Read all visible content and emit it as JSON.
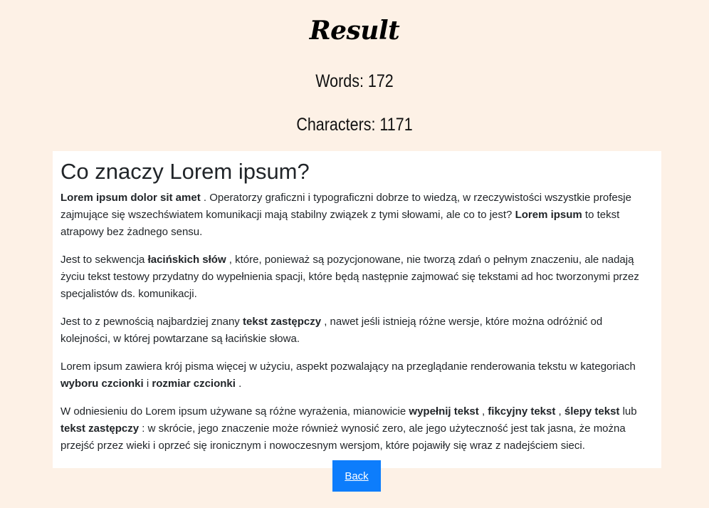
{
  "header": {
    "title": "Result",
    "words": "Words: 172",
    "characters": "Characters: 1171"
  },
  "article": {
    "heading": "Co znaczy Lorem ipsum?",
    "p1": {
      "b1": "Lorem ipsum dolor sit amet",
      "t1": " . Operatorzy graficzni i typograficzni dobrze to wiedzą, w rzeczywistości wszystkie profesje zajmujące się wszechświatem komunikacji mają stabilny związek z tymi słowami, ale co to jest? ",
      "b2": "Lorem ipsum",
      "t2": " to tekst atrapowy bez żadnego sensu."
    },
    "p2": {
      "t1": "Jest to sekwencja ",
      "b1": "łacińskich słów",
      "t2": " , które, ponieważ są pozycjonowane, nie tworzą zdań o pełnym znaczeniu, ale nadają życiu tekst testowy przydatny do wypełnienia spacji, które będą następnie zajmować się tekstami ad hoc tworzonymi przez specjalistów ds. komunikacji."
    },
    "p3": {
      "t1": "Jest to z pewnością najbardziej znany ",
      "b1": "tekst zastępczy",
      "t2": " , nawet jeśli istnieją różne wersje, które można odróżnić od kolejności, w której powtarzane są łacińskie słowa."
    },
    "p4": {
      "t1": "Lorem ipsum zawiera krój pisma więcej w użyciu, aspekt pozwalający na przeglądanie renderowania tekstu w kategoriach ",
      "b1": "wyboru czcionki",
      "t2": " i ",
      "b2": "rozmiar czcionki",
      "t3": " ."
    },
    "p5": {
      "t1": "W odniesieniu do Lorem ipsum używane są różne wyrażenia, mianowicie ",
      "b1": "wypełnij tekst",
      "t2": " , ",
      "b2": "fikcyjny tekst",
      "t3": " , ",
      "b3": "ślepy tekst",
      "t4": " lub ",
      "b4": "tekst zastępczy",
      "t5": " : w skrócie, jego znaczenie może również wynosić zero, ale jego użyteczność jest tak jasna, że można przejść przez wieki i oprzeć się ironicznym i nowoczesnym wersjom, które pojawiły się wraz z nadejściem sieci."
    }
  },
  "back_button": {
    "label": "Back"
  },
  "colors": {
    "background": "#fdf1e6",
    "card": "#ffffff",
    "button": "#0d7dfc"
  }
}
